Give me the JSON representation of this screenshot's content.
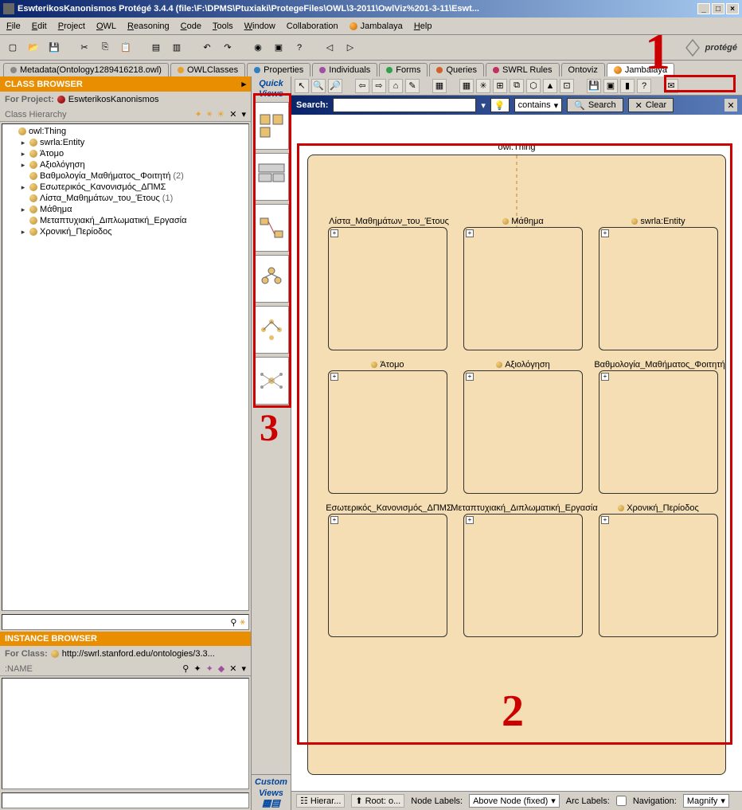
{
  "title": "EswterikosKanonismos  Protégé 3.4.4    (file:\\F:\\DPMS\\Ptuxiaki\\ProtegeFiles\\OWL\\3-2011\\OwlViz%201-3-11\\Eswt...",
  "menu": {
    "file": "File",
    "edit": "Edit",
    "project": "Project",
    "owl": "OWL",
    "reasoning": "Reasoning",
    "code": "Code",
    "tools": "Tools",
    "window": "Window",
    "collaboration": "Collaboration",
    "selected": "Jambalaya",
    "help": "Help"
  },
  "logo": "protégé",
  "tabs": [
    {
      "label": "Metadata(Ontology1289416218.owl)",
      "color": "#888"
    },
    {
      "label": "OWLClasses",
      "color": "#e8a030"
    },
    {
      "label": "Properties",
      "color": "#3080c0"
    },
    {
      "label": "Individuals",
      "color": "#a050a0"
    },
    {
      "label": "Forms",
      "color": "#30a050"
    },
    {
      "label": "Queries",
      "color": "#d06030"
    },
    {
      "label": "SWRL Rules",
      "color": "#c03060"
    },
    {
      "label": "Ontoviz",
      "color": "#888"
    },
    {
      "label": "Jambalaya",
      "color": "#333"
    }
  ],
  "classBrowser": {
    "title": "CLASS BROWSER",
    "forProject": "For Project:",
    "projectName": "EswterikosKanonismos",
    "hierarchyTitle": "Class Hierarchy",
    "tree": [
      {
        "label": "owl:Thing",
        "indent": 0,
        "arrow": ""
      },
      {
        "label": "swrla:Entity",
        "indent": 1,
        "arrow": "▸"
      },
      {
        "label": "Άτομο",
        "indent": 1,
        "arrow": "▸"
      },
      {
        "label": "Αξιολόγηση",
        "indent": 1,
        "arrow": "▸"
      },
      {
        "label": "Βαθμολογία_Μαθήματος_Φοιτητή",
        "indent": 1,
        "arrow": "",
        "count": "(2)"
      },
      {
        "label": "Εσωτερικός_Κανονισμός_ΔΠΜΣ",
        "indent": 1,
        "arrow": "▸"
      },
      {
        "label": "Λίστα_Μαθημάτων_του_Έτους",
        "indent": 1,
        "arrow": "",
        "count": "(1)"
      },
      {
        "label": "Μάθημα",
        "indent": 1,
        "arrow": "▸"
      },
      {
        "label": "Μεταπτυχιακή_Διπλωματική_Εργασία",
        "indent": 1,
        "arrow": ""
      },
      {
        "label": "Χρονική_Περίοδος",
        "indent": 1,
        "arrow": "▸"
      }
    ]
  },
  "instanceBrowser": {
    "title": "INSTANCE BROWSER",
    "forClass": "For Class:",
    "className": "http://swrl.stanford.edu/ontologies/3.3...",
    "nameLabel": ":NAME"
  },
  "quickViews": {
    "title1": "Quick",
    "title2": "Views",
    "custom1": "Custom",
    "custom2": "Views"
  },
  "searchBar": {
    "label": "Search:",
    "mode": "contains",
    "searchBtn": "Search",
    "clearBtn": "Clear"
  },
  "canvas": {
    "root": "owl:Thing",
    "boxes": [
      {
        "label": "Λίστα_Μαθημάτων_του_Έτους",
        "row": 0,
        "col": 0
      },
      {
        "label": "Μάθημα",
        "row": 0,
        "col": 1
      },
      {
        "label": "swrla:Entity",
        "row": 0,
        "col": 2
      },
      {
        "label": "Άτομο",
        "row": 1,
        "col": 0
      },
      {
        "label": "Αξιολόγηση",
        "row": 1,
        "col": 1
      },
      {
        "label": "Βαθμολογία_Μαθήματος_Φοιτητή",
        "row": 1,
        "col": 2
      },
      {
        "label": "Εσωτερικός_Κανονισμός_ΔΠΜΣ",
        "row": 2,
        "col": 0
      },
      {
        "label": "Μεταπτυχιακή_Διπλωματική_Εργασία",
        "row": 2,
        "col": 1
      },
      {
        "label": "Χρονική_Περίοδος",
        "row": 2,
        "col": 2
      }
    ]
  },
  "statusBar": {
    "hierar": "Hierar...",
    "root": "Root: o...",
    "nodeLabels": "Node Labels:",
    "nodeLabelsVal": "Above Node (fixed)",
    "arcLabels": "Arc Labels:",
    "navigation": "Navigation:",
    "navigationVal": "Magnify"
  },
  "annotations": {
    "n1": "1",
    "n2": "2",
    "n3": "3"
  }
}
